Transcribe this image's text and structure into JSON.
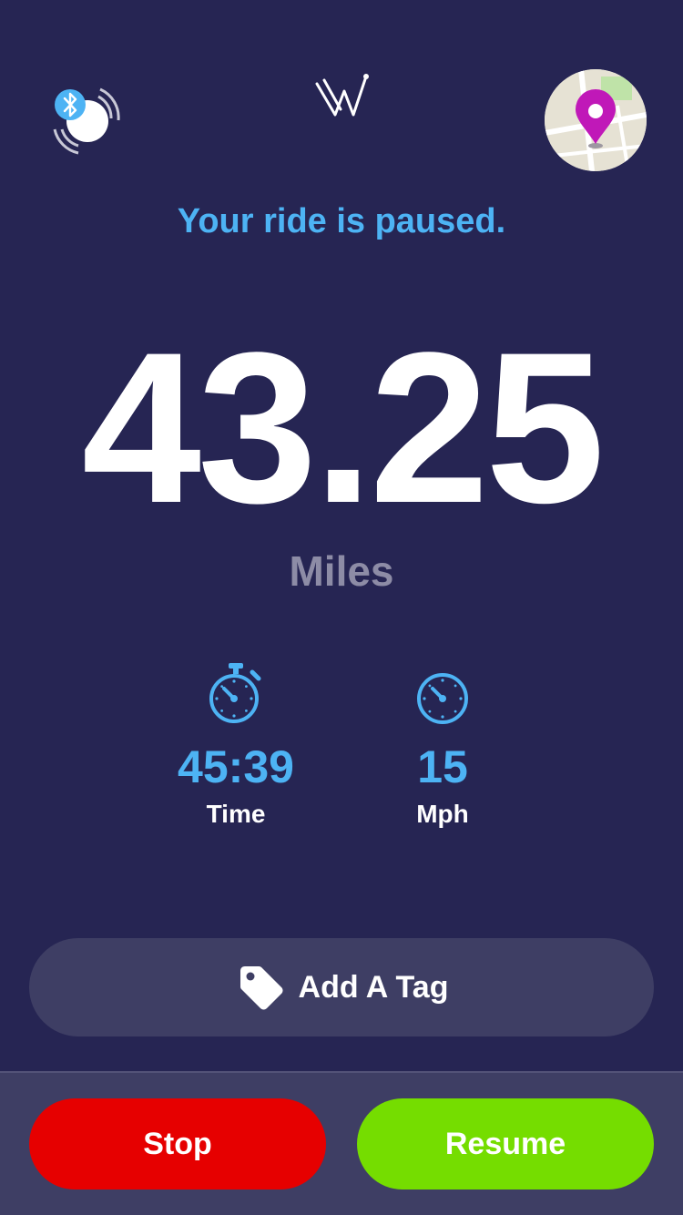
{
  "header": {
    "bluetooth_icon": "bluetooth-sensor-icon",
    "logo_icon": "app-logo-icon",
    "map_icon": "map-location-icon"
  },
  "ride": {
    "status": "Your ride is paused.",
    "distance": "43.25",
    "distance_unit": "Miles"
  },
  "stats": {
    "time": {
      "value": "45:39",
      "label": "Time",
      "icon": "stopwatch-icon"
    },
    "speed": {
      "value": "15",
      "label": "Mph",
      "icon": "speedometer-icon"
    }
  },
  "tag": {
    "label": "Add A Tag",
    "icon": "tag-icon"
  },
  "actions": {
    "stop_label": "Stop",
    "resume_label": "Resume"
  },
  "colors": {
    "background": "#262553",
    "accent": "#4db3f4",
    "stop": "#e60000",
    "resume": "#75dd00",
    "pin": "#c018b8"
  }
}
